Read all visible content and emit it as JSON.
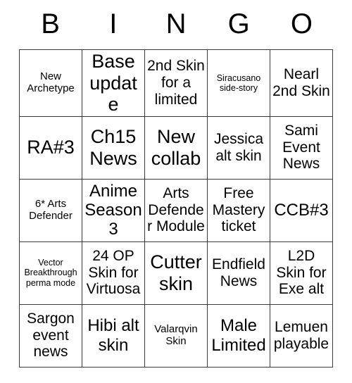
{
  "card": {
    "header": {
      "letters": [
        "B",
        "I",
        "N",
        "G",
        "O"
      ]
    },
    "rows": [
      [
        {
          "text": "New Archetype",
          "size": "sz-sm"
        },
        {
          "text": "Base update",
          "size": "sz-xl"
        },
        {
          "text": "2nd Skin for a limited",
          "size": "sz-md"
        },
        {
          "text": "Siracusano side-story",
          "size": "sz-xs"
        },
        {
          "text": "Nearl 2nd Skin",
          "size": "sz-md"
        }
      ],
      [
        {
          "text": "RA#3",
          "size": "sz-xl"
        },
        {
          "text": "Ch15 News",
          "size": "sz-xl"
        },
        {
          "text": "New collab",
          "size": "sz-xl"
        },
        {
          "text": "Jessica alt skin",
          "size": "sz-md"
        },
        {
          "text": "Sami Event News",
          "size": "sz-md"
        }
      ],
      [
        {
          "text": "6* Arts Defender",
          "size": "sz-sm"
        },
        {
          "text": "Anime Season 3",
          "size": "sz-lg"
        },
        {
          "text": "Arts Defender Module",
          "size": "sz-md"
        },
        {
          "text": "Free Mastery ticket",
          "size": "sz-md"
        },
        {
          "text": "CCB#3",
          "size": "sz-lg"
        }
      ],
      [
        {
          "text": "Vector Breakthrough perma mode",
          "size": "sz-xs"
        },
        {
          "text": "24 OP Skin for Virtuosa",
          "size": "sz-md"
        },
        {
          "text": "Cutter skin",
          "size": "sz-xl"
        },
        {
          "text": "Endfield News",
          "size": "sz-md"
        },
        {
          "text": "L2D Skin for Exe alt",
          "size": "sz-md"
        }
      ],
      [
        {
          "text": "Sargon event news",
          "size": "sz-md"
        },
        {
          "text": "Hibi alt skin",
          "size": "sz-lg"
        },
        {
          "text": "Valarqvin Skin",
          "size": "sz-sm"
        },
        {
          "text": "Male Limited",
          "size": "sz-lg"
        },
        {
          "text": "Lemuen playable",
          "size": "sz-md"
        }
      ]
    ]
  }
}
